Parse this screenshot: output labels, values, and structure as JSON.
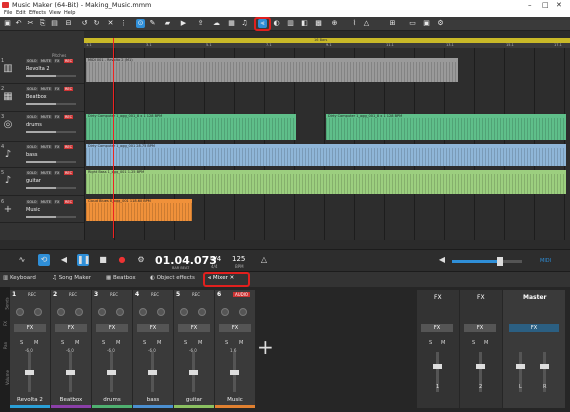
{
  "window": {
    "title": "Music Maker (64-Bit) - Making_Music.mmm"
  },
  "menu": [
    "File",
    "Edit",
    "Effects",
    "View",
    "Help"
  ],
  "timeline": {
    "bar_range": "16 Bars",
    "ticks": [
      "1.1",
      "3.1",
      "5.1",
      "7.1",
      "9.1",
      "11.1",
      "13.1",
      "15.1",
      "17.1"
    ]
  },
  "left_panel": {
    "header": "Pitches"
  },
  "tracks": [
    {
      "num": "1",
      "name": "Revolta 2",
      "icon": "keyboard-icon",
      "clip": "MIDI 001 - Revolta 2 (M1)",
      "color": "#9a9a9a"
    },
    {
      "num": "2",
      "name": "Beatbox",
      "icon": "beatbox-icon",
      "clip": "",
      "color": "#333"
    },
    {
      "num": "3",
      "name": "drums",
      "icon": "drums-icon",
      "clip": "Dirty Computer 1_ogg_001_8 x 1 128 BPM",
      "color": "#5fbf8a"
    },
    {
      "num": "4",
      "name": "bass",
      "icon": "guitar-icon",
      "clip": "Dirty Computer 1_ogg_001 28.75 BPM",
      "color": "#8fb6d8"
    },
    {
      "num": "5",
      "name": "guitar",
      "icon": "guitar-icon",
      "clip": "Right Bass 1_ogg_001 1.25 BPM",
      "color": "#9ccf7f"
    },
    {
      "num": "6",
      "name": "Music",
      "icon": "plus-icon",
      "clip": "Cloud Blues 8_ogg_001 118.60 BPM",
      "color": "#f0913a"
    }
  ],
  "track_buttons": {
    "solo": "SOLO",
    "mute": "MUTE",
    "fx": "FX",
    "rec": "REC"
  },
  "transport": {
    "time": "01.04.073",
    "time_sub": "BAR BEAT",
    "signature": "4/4",
    "signature_sub": "4/4",
    "bpm": "125",
    "bpm_sub": "BPM",
    "midi": "MIDI"
  },
  "tabs": [
    {
      "label": "Keyboard",
      "icon": "keyboard-icon"
    },
    {
      "label": "Song Maker",
      "icon": "music-note-icon"
    },
    {
      "label": "Beatbox",
      "icon": "grid-icon"
    },
    {
      "label": "Object effects",
      "icon": "effects-icon"
    },
    {
      "label": "Mixer",
      "icon": "mixer-icon"
    }
  ],
  "mixer": {
    "side_labels": [
      "Sends",
      "FX",
      "Pan",
      "Volume"
    ],
    "channels": [
      {
        "num": "1",
        "label": "REC",
        "name": "Revolta 2",
        "vol": "-6.0",
        "color": "#2a9fd6"
      },
      {
        "num": "2",
        "label": "REC",
        "name": "Beatbox",
        "vol": "-6.0",
        "color": "#8b3fa8"
      },
      {
        "num": "3",
        "label": "REC",
        "name": "drums",
        "vol": "-6.0",
        "color": "#4fb070"
      },
      {
        "num": "4",
        "label": "REC",
        "name": "bass",
        "vol": "-6.0",
        "color": "#4b8fd0"
      },
      {
        "num": "5",
        "label": "REC",
        "name": "guitar",
        "vol": "-6.0",
        "color": "#8bc060"
      },
      {
        "num": "6",
        "label": "AUDIO",
        "name": "Music",
        "vol": "1.6",
        "color": "#e08030"
      }
    ],
    "fx_label": "FX",
    "sm": [
      "S",
      "M"
    ],
    "fx_returns": [
      {
        "name": "1",
        "title": "FX"
      },
      {
        "name": "2",
        "title": "FX"
      }
    ],
    "master": {
      "title": "Master",
      "fx": "FX",
      "l": "L",
      "r": "R"
    }
  },
  "colors": {
    "accent": "#2f8fd8",
    "highlight": "#e0201e",
    "ruler": "#c9b928"
  }
}
